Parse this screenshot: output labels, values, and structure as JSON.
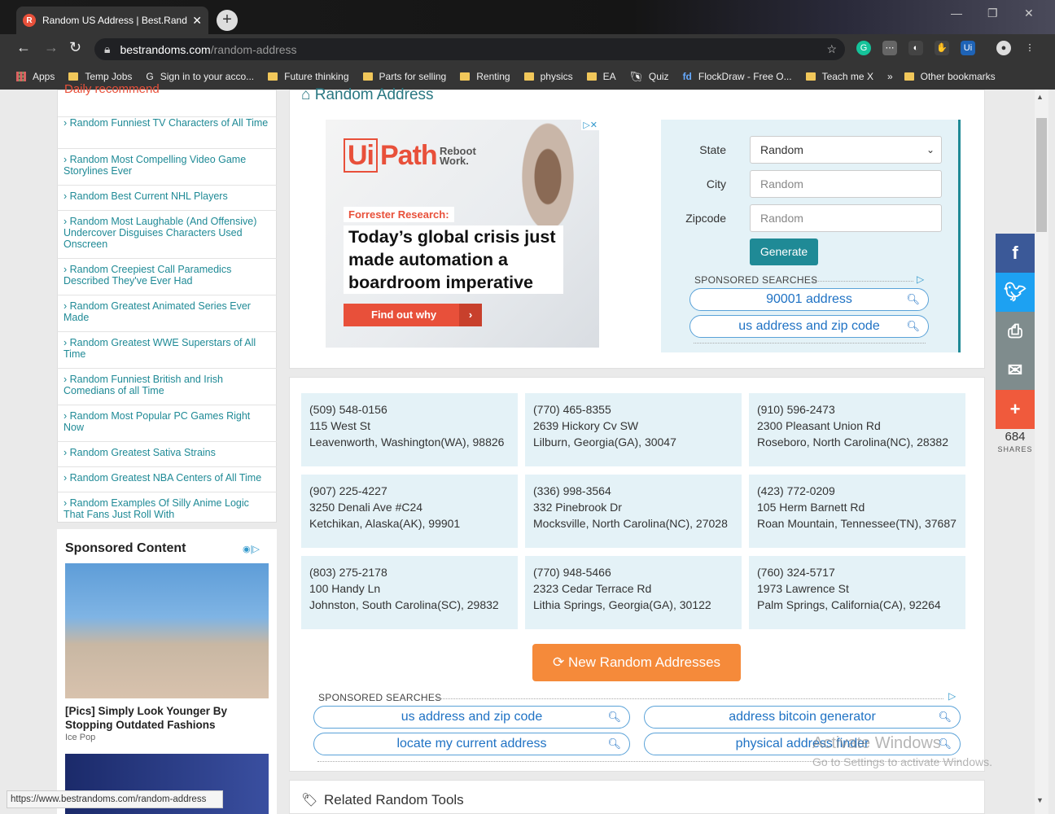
{
  "browser": {
    "tab_title": "Random US Address | Best.Rand",
    "url_host": "bestrandoms.com",
    "url_path": "/random-address",
    "bookmarks": [
      "Apps",
      "Temp Jobs",
      "Sign in to your acco...",
      "Future thinking",
      "Parts for selling",
      "Renting",
      "physics",
      "EA",
      "Quiz",
      "FlockDraw - Free O...",
      "Teach me X",
      "»",
      "Other bookmarks"
    ]
  },
  "sidebar": {
    "header": "Daily recommend",
    "items": [
      "› Random Funniest TV Characters of All Time",
      "› Random Most Compelling Video Game Storylines Ever",
      "› Random Best Current NHL Players",
      "› Random Most Laughable (And Offensive) Undercover Disguises Characters Used Onscreen",
      "› Random Creepiest Call Paramedics Described They've Ever Had",
      "› Random Greatest Animated Series Ever Made",
      "› Random Greatest WWE Superstars of All Time",
      "› Random Funniest British and Irish Comedians of all Time",
      "› Random Most Popular PC Games Right Now",
      "› Random Greatest Sativa Strains",
      "› Random Greatest NBA Centers of All Time",
      "› Random Examples Of Silly Anime Logic That Fans Just Roll With"
    ]
  },
  "sponsored": {
    "title": "Sponsored Content",
    "caption": "[Pics] Simply Look Younger By Stopping Outdated Fashions",
    "source": "Ice Pop"
  },
  "main": {
    "title": "Random Address",
    "ad": {
      "brand": "Path",
      "brand_box": "Ui",
      "tagline": "Reboot Work.",
      "label": "Forrester Research:",
      "headline": "Today’s global crisis just made automation a boardroom imperative",
      "cta": "Find out why"
    },
    "form": {
      "state_label": "State",
      "state_value": "Random",
      "city_label": "City",
      "city_placeholder": "Random",
      "zip_label": "Zipcode",
      "zip_placeholder": "Random",
      "generate": "Generate",
      "sponsored_label": "SPONSORED SEARCHES",
      "searches": [
        "90001 address",
        "us address and zip code"
      ]
    },
    "addresses": [
      {
        "phone": "(509) 548-0156",
        "street": "115 West St",
        "city": "Leavenworth, Washington(WA), 98826"
      },
      {
        "phone": "(770) 465-8355",
        "street": "2639 Hickory Cv SW",
        "city": "Lilburn, Georgia(GA), 30047"
      },
      {
        "phone": "(910) 596-2473",
        "street": "2300 Pleasant Union Rd",
        "city": "Roseboro, North Carolina(NC), 28382"
      },
      {
        "phone": "(907) 225-4227",
        "street": "3250 Denali Ave #C24",
        "city": "Ketchikan, Alaska(AK), 99901"
      },
      {
        "phone": "(336) 998-3564",
        "street": "332 Pinebrook Dr",
        "city": "Mocksville, North Carolina(NC), 27028"
      },
      {
        "phone": "(423) 772-0209",
        "street": "105 Herm Barnett Rd",
        "city": "Roan Mountain, Tennessee(TN), 37687"
      },
      {
        "phone": "(803) 275-2178",
        "street": "100 Handy Ln",
        "city": "Johnston, South Carolina(SC), 29832"
      },
      {
        "phone": "(770) 948-5466",
        "street": "2323 Cedar Terrace Rd",
        "city": "Lithia Springs, Georgia(GA), 30122"
      },
      {
        "phone": "(760) 324-5717",
        "street": "1973 Lawrence St",
        "city": "Palm Springs, California(CA), 92264"
      }
    ],
    "new_button": "New Random Addresses",
    "bottom_sponsored_label": "SPONSORED SEARCHES",
    "bottom_searches": [
      "us address and zip code",
      "address bitcoin generator",
      "locate my current address",
      "physical address finder"
    ],
    "related_title": "Related Random Tools"
  },
  "share": {
    "count": "684",
    "label": "SHARES",
    "colors": {
      "facebook": "#3b5998",
      "twitter": "#1da1f2",
      "print": "#7f8c8d",
      "email": "#7f8c8d",
      "more": "#f05a3c"
    }
  },
  "status_url": "https://www.bestrandoms.com/random-address",
  "watermark": {
    "line1": "Activate Windows",
    "line2": "Go to Settings to activate Windows."
  }
}
